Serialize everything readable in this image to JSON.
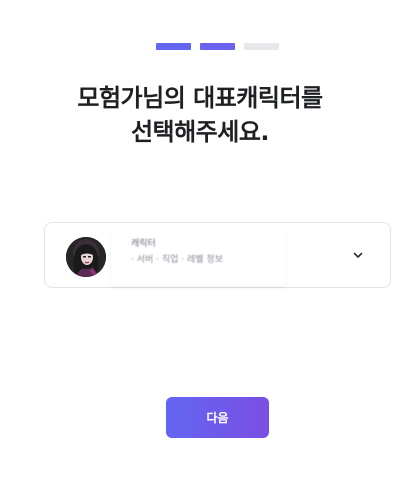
{
  "progress": {
    "current_step": 2,
    "total_steps": 3,
    "colors": {
      "active": "#6366f1",
      "inactive": "#e7e8ec"
    }
  },
  "title": {
    "line1": "모험가님의 대표캐릭터를",
    "line2": "선택해주세요."
  },
  "character_select": {
    "name": "캐릭터",
    "detail": "· 서버 · 직업 · 레벨 정보",
    "avatar_icon": "character-portrait",
    "dropdown_icon": "chevron-down-icon"
  },
  "next_button": {
    "label": "다음",
    "color": "#6366f1"
  }
}
